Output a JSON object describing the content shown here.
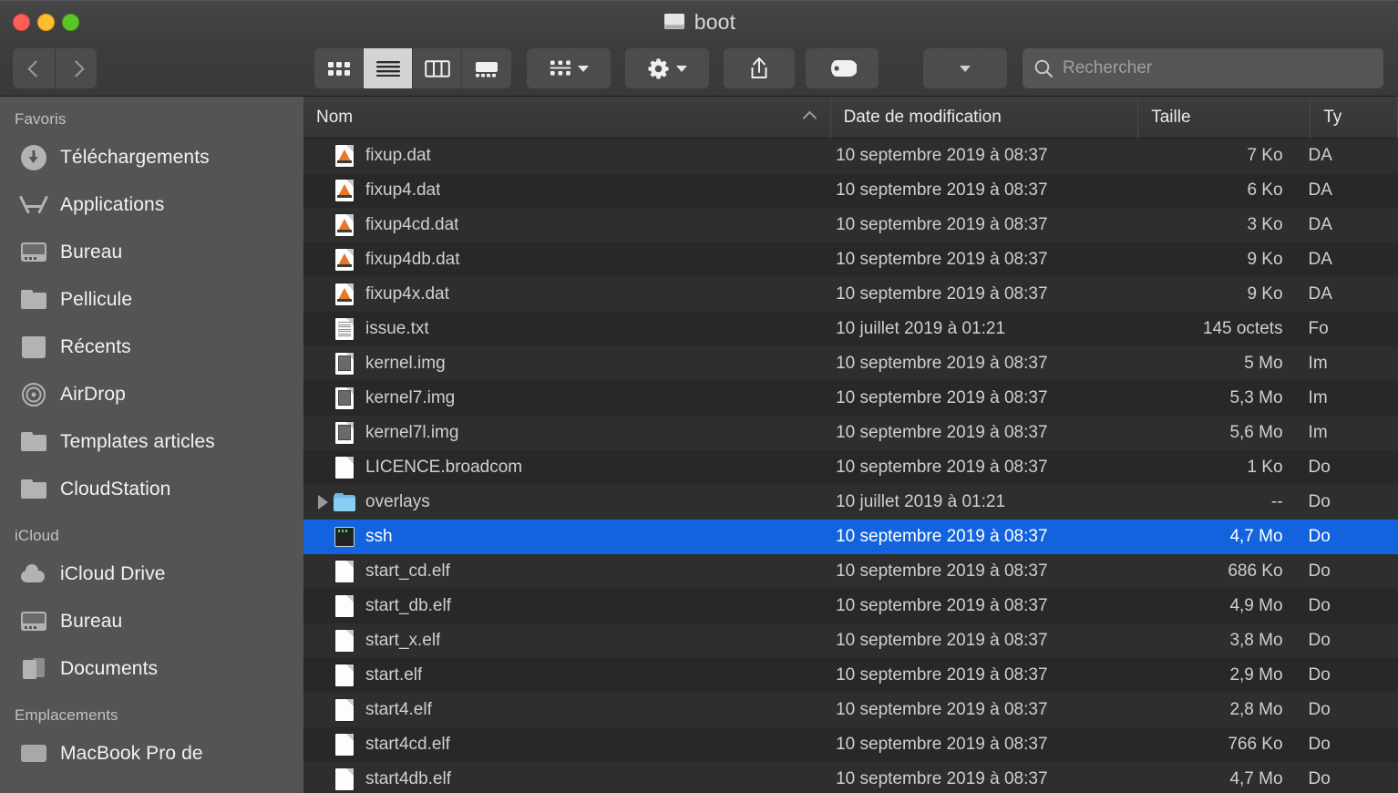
{
  "window": {
    "title": "boot",
    "title_icon": "hard-disk-icon",
    "traffic_lights": [
      {
        "name": "close-button",
        "color": "#ff5f57"
      },
      {
        "name": "minimize-button",
        "color": "#febc2e"
      },
      {
        "name": "maximize-button",
        "color": "#5bc526"
      }
    ]
  },
  "toolbar": {
    "back_icon": "chevron-left-icon",
    "forward_icon": "chevron-right-icon",
    "views": [
      {
        "name": "icon-view",
        "icon": "grid-icon",
        "active": false
      },
      {
        "name": "list-view",
        "icon": "list-icon",
        "active": true
      },
      {
        "name": "column-view",
        "icon": "columns-icon",
        "active": false
      },
      {
        "name": "gallery-view",
        "icon": "gallery-icon",
        "active": false
      }
    ],
    "group_by": {
      "name": "group-by-button",
      "icon": "group-icon"
    },
    "actions": {
      "name": "actions-button",
      "icon": "gear-icon"
    },
    "share": {
      "name": "share-button",
      "icon": "share-icon"
    },
    "tags": {
      "name": "tags-button",
      "icon": "tag-icon"
    },
    "arrange": {
      "name": "arrange-button",
      "icon": "chevron-down-icon"
    }
  },
  "search": {
    "placeholder": "Rechercher",
    "value": "",
    "icon": "search-icon"
  },
  "sidebar": {
    "sections": [
      {
        "title": "Favoris",
        "items": [
          {
            "label": "Téléchargements",
            "icon": "downloads-icon"
          },
          {
            "label": "Applications",
            "icon": "applications-icon"
          },
          {
            "label": "Bureau",
            "icon": "desktop-icon"
          },
          {
            "label": "Pellicule",
            "icon": "folder-icon"
          },
          {
            "label": "Récents",
            "icon": "recents-icon"
          },
          {
            "label": "AirDrop",
            "icon": "airdrop-icon"
          },
          {
            "label": "Templates articles",
            "icon": "folder-icon"
          },
          {
            "label": "CloudStation",
            "icon": "folder-icon"
          }
        ]
      },
      {
        "title": "iCloud",
        "items": [
          {
            "label": "iCloud Drive",
            "icon": "cloud-icon"
          },
          {
            "label": "Bureau",
            "icon": "desktop-icon"
          },
          {
            "label": "Documents",
            "icon": "documents-icon"
          }
        ]
      },
      {
        "title": "Emplacements",
        "items": [
          {
            "label": "MacBook Pro de",
            "icon": "laptop-icon"
          }
        ]
      }
    ]
  },
  "filelist": {
    "columns": [
      {
        "label": "Nom",
        "sort": "asc",
        "sort_icon": "chevron-up-icon"
      },
      {
        "label": "Date de modification",
        "sort": null
      },
      {
        "label": "Taille",
        "sort": null
      },
      {
        "label": "Ty",
        "sort": null
      }
    ],
    "selection_color": "#1363df",
    "rows": [
      {
        "name": "fixup.dat",
        "icon": "vlc-document-icon",
        "date": "10 septembre 2019 à 08:37",
        "size": "7 Ko",
        "type": "DA",
        "selected": false,
        "expandable": false
      },
      {
        "name": "fixup4.dat",
        "icon": "vlc-document-icon",
        "date": "10 septembre 2019 à 08:37",
        "size": "6 Ko",
        "type": "DA",
        "selected": false,
        "expandable": false
      },
      {
        "name": "fixup4cd.dat",
        "icon": "vlc-document-icon",
        "date": "10 septembre 2019 à 08:37",
        "size": "3 Ko",
        "type": "DA",
        "selected": false,
        "expandable": false
      },
      {
        "name": "fixup4db.dat",
        "icon": "vlc-document-icon",
        "date": "10 septembre 2019 à 08:37",
        "size": "9 Ko",
        "type": "DA",
        "selected": false,
        "expandable": false
      },
      {
        "name": "fixup4x.dat",
        "icon": "vlc-document-icon",
        "date": "10 septembre 2019 à 08:37",
        "size": "9 Ko",
        "type": "DA",
        "selected": false,
        "expandable": false
      },
      {
        "name": "issue.txt",
        "icon": "text-document-icon",
        "date": "10 juillet 2019 à 01:21",
        "size": "145 octets",
        "type": "Fo",
        "selected": false,
        "expandable": false
      },
      {
        "name": "kernel.img",
        "icon": "image-document-icon",
        "date": "10 septembre 2019 à 08:37",
        "size": "5 Mo",
        "type": "Im",
        "selected": false,
        "expandable": false
      },
      {
        "name": "kernel7.img",
        "icon": "image-document-icon",
        "date": "10 septembre 2019 à 08:37",
        "size": "5,3 Mo",
        "type": "Im",
        "selected": false,
        "expandable": false
      },
      {
        "name": "kernel7l.img",
        "icon": "image-document-icon",
        "date": "10 septembre 2019 à 08:37",
        "size": "5,6 Mo",
        "type": "Im",
        "selected": false,
        "expandable": false
      },
      {
        "name": "LICENCE.broadcom",
        "icon": "blank-document-icon",
        "date": "10 septembre 2019 à 08:37",
        "size": "1 Ko",
        "type": "Do",
        "selected": false,
        "expandable": false
      },
      {
        "name": "overlays",
        "icon": "folder-icon",
        "date": "10 juillet 2019 à 01:21",
        "size": "--",
        "type": "Do",
        "selected": false,
        "expandable": true
      },
      {
        "name": "ssh",
        "icon": "terminal-icon",
        "date": "10 septembre 2019 à 08:37",
        "size": "4,7 Mo",
        "type": "Do",
        "selected": true,
        "expandable": false
      },
      {
        "name": "start_cd.elf",
        "icon": "blank-document-icon",
        "date": "10 septembre 2019 à 08:37",
        "size": "686 Ko",
        "type": "Do",
        "selected": false,
        "expandable": false
      },
      {
        "name": "start_db.elf",
        "icon": "blank-document-icon",
        "date": "10 septembre 2019 à 08:37",
        "size": "4,9 Mo",
        "type": "Do",
        "selected": false,
        "expandable": false
      },
      {
        "name": "start_x.elf",
        "icon": "blank-document-icon",
        "date": "10 septembre 2019 à 08:37",
        "size": "3,8 Mo",
        "type": "Do",
        "selected": false,
        "expandable": false
      },
      {
        "name": "start.elf",
        "icon": "blank-document-icon",
        "date": "10 septembre 2019 à 08:37",
        "size": "2,9 Mo",
        "type": "Do",
        "selected": false,
        "expandable": false
      },
      {
        "name": "start4.elf",
        "icon": "blank-document-icon",
        "date": "10 septembre 2019 à 08:37",
        "size": "2,8 Mo",
        "type": "Do",
        "selected": false,
        "expandable": false
      },
      {
        "name": "start4cd.elf",
        "icon": "blank-document-icon",
        "date": "10 septembre 2019 à 08:37",
        "size": "766 Ko",
        "type": "Do",
        "selected": false,
        "expandable": false
      },
      {
        "name": "start4db.elf",
        "icon": "blank-document-icon",
        "date": "10 septembre 2019 à 08:37",
        "size": "4,7 Mo",
        "type": "Do",
        "selected": false,
        "expandable": false
      }
    ]
  }
}
